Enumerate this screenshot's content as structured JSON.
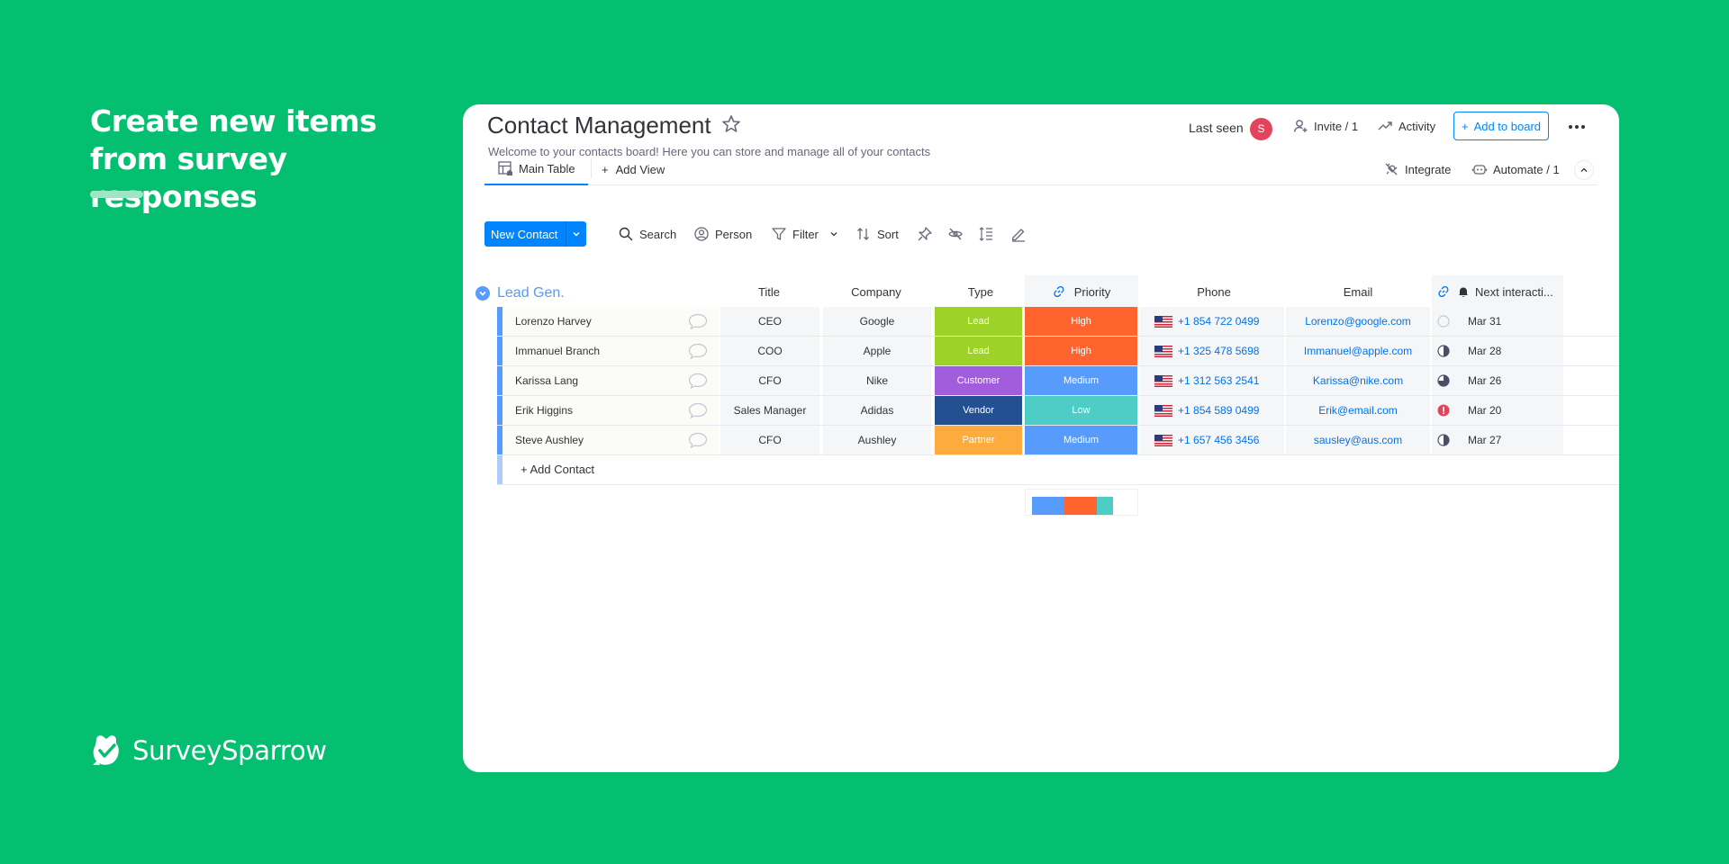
{
  "hero": {
    "headline": "Create new items from survey responses",
    "brand": "SurveySparrow"
  },
  "board": {
    "title": "Contact Management",
    "description": "Welcome to your contacts board! Here you can store and manage all of your contacts",
    "last_seen_label": "Last seen",
    "avatar_initial": "S",
    "invite_label": "Invite / 1",
    "activity_label": "Activity",
    "add_to_board_label": "Add to board"
  },
  "views": {
    "main_table": "Main Table",
    "add_view": "Add View",
    "integrate": "Integrate",
    "automate": "Automate / 1"
  },
  "toolbar": {
    "new_item": "New Contact",
    "search": "Search",
    "person": "Person",
    "filter": "Filter",
    "sort": "Sort"
  },
  "table": {
    "group_name": "Lead Gen.",
    "columns": {
      "title": "Title",
      "company": "Company",
      "type": "Type",
      "priority": "Priority",
      "phone": "Phone",
      "email": "Email",
      "next": "Next interacti..."
    },
    "rows": [
      {
        "name": "Lorenzo Harvey",
        "title": "CEO",
        "company": "Google",
        "type": "Lead",
        "type_color": "#9cd326",
        "priority": "High",
        "priority_color": "#ff642e",
        "phone": "+1 854 722 0499",
        "email": "Lorenzo@google.com",
        "progress": 0,
        "date": "Mar 31"
      },
      {
        "name": "Immanuel Branch",
        "title": "COO",
        "company": "Apple",
        "type": "Lead",
        "type_color": "#9cd326",
        "priority": "High",
        "priority_color": "#ff642e",
        "phone": "+1 325 478 5698",
        "email": "Immanuel@apple.com",
        "progress": 0.5,
        "date": "Mar 28"
      },
      {
        "name": "Karissa Lang",
        "title": "CFO",
        "company": "Nike",
        "type": "Customer",
        "type_color": "#a25ddc",
        "priority": "Medium",
        "priority_color": "#579bfc",
        "phone": "+1 312 563 2541",
        "email": "Karissa@nike.com",
        "progress": 0.75,
        "date": "Mar 26"
      },
      {
        "name": "Erik Higgins",
        "title": "Sales Manager",
        "company": "Adidas",
        "type": "Vendor",
        "type_color": "#225091",
        "priority": "Low",
        "priority_color": "#4eccc6",
        "phone": "+1 854 589 0499",
        "email": "Erik@email.com",
        "progress": -1,
        "date": "Mar 20"
      },
      {
        "name": "Steve Aushley",
        "title": "CFO",
        "company": "Aushley",
        "type": "Partner",
        "type_color": "#fdab3d",
        "priority": "Medium",
        "priority_color": "#579bfc",
        "phone": "+1 657 456 3456",
        "email": "sausley@aus.com",
        "progress": 0.5,
        "date": "Mar 27"
      }
    ],
    "add_item": "+ Add Contact",
    "priority_summary": [
      {
        "color": "#579bfc",
        "share": 0.4
      },
      {
        "color": "#ff642e",
        "share": 0.4
      },
      {
        "color": "#4eccc6",
        "share": 0.2
      }
    ]
  }
}
